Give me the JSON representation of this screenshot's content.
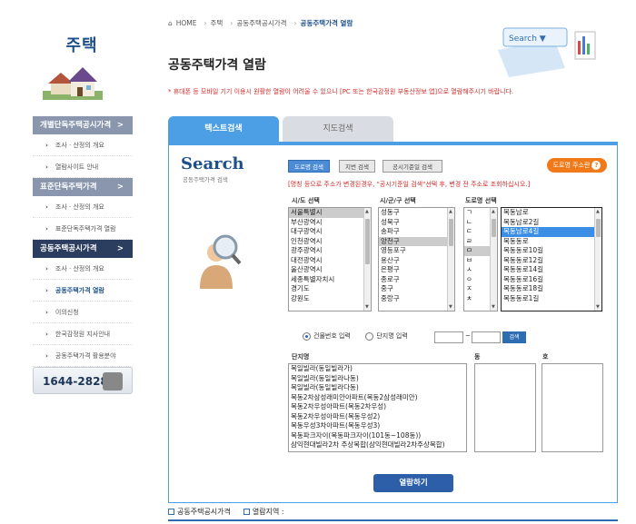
{
  "sidebar": {
    "title": "주택",
    "menu": [
      {
        "type": "head",
        "label": "개별단독주택공시가격",
        "arrow": ">"
      },
      {
        "type": "item",
        "label": "조사 · 산정의 개요"
      },
      {
        "type": "item",
        "label": "열람사이트 안내"
      },
      {
        "type": "head",
        "label": "표준단독주택가격",
        "arrow": ">"
      },
      {
        "type": "item",
        "label": "조사 · 산정의 개요"
      },
      {
        "type": "item",
        "label": "표준단독주택가격 열람"
      },
      {
        "type": "head-active",
        "label": "공동주택공시가격",
        "arrow": ">"
      },
      {
        "type": "item",
        "label": "조사 · 산정의 개요"
      },
      {
        "type": "item-current",
        "label": "공동주택가격 열람"
      },
      {
        "type": "item",
        "label": "이의신청"
      },
      {
        "type": "item",
        "label": "한국감정원 지사안내"
      },
      {
        "type": "item",
        "label": "공동주택가격 활용분야"
      }
    ],
    "phone": "1644-2828"
  },
  "breadcrumb": {
    "home": "HOME",
    "c1": "주택",
    "c2": "공동주택공시가격",
    "current": "공동주택가격 열람"
  },
  "header": {
    "title": "공동주택가격 열람",
    "notice": "* 휴대폰 등 모바일 기기 이용시 원활한 열람이 어려울 수 있으니 [PC 또는 한국감정원 부동산정보 앱]으로 열람해주시기 바랍니다.",
    "deco_text": "Search ▼"
  },
  "tabs": {
    "text": "텍스트검색",
    "map": "지도검색"
  },
  "search": {
    "logo": "Search",
    "logo_sub": "공동주택가격 검색",
    "btn_road": "도로명 검색",
    "btn_jibun": "지번 검색",
    "btn_date": "공시기준일 검색",
    "btn_addr": "도로명 주소란",
    "warning": "[명칭 등으로 주소가 변경된경우, \"공시기준일 검색\"선택 후, 변경 전 주소로 조회하십시오.]",
    "label_sido": "시/도 선택",
    "label_sigungu": "시/군/구 선택",
    "label_road": "도로명 선택",
    "sido": [
      "서울특별시",
      "부산광역시",
      "대구광역시",
      "인천광역시",
      "광주광역시",
      "대전광역시",
      "울산광역시",
      "세종특별자치시",
      "경기도",
      "강원도"
    ],
    "sigungu": [
      "성동구",
      "성북구",
      "송파구",
      "양천구",
      "영등포구",
      "용산구",
      "은평구",
      "종로구",
      "중구",
      "중랑구"
    ],
    "initials": [
      "ㄱ",
      "ㄴ",
      "ㄷ",
      "ㄹ",
      "ㅁ",
      "ㅂ",
      "ㅅ",
      "ㅇ",
      "ㅈ",
      "ㅊ"
    ],
    "roads": [
      "목동남로",
      "목동남로2길",
      "목동남로4길",
      "목동동로",
      "목동동로10길",
      "목동동로12길",
      "목동동로14길",
      "목동동로16길",
      "목동동로18길",
      "목동동로1길"
    ],
    "radio_building": "건물번호 입력",
    "radio_complex": "단지명 입력",
    "dash": "~",
    "btn_search_small": "검색",
    "label_complex": "단지명",
    "label_dong": "동",
    "label_ho": "호",
    "complexes": [
      "목일빌라(동일빌라가)",
      "목일빌라(동일빌라나동)",
      "목일빌라(동일빌라다동)",
      "목동2차삼성래미안아파트(목동2삼성래미안)",
      "목동2차우성아파트(목동2차우성)",
      "목동2차우성아파트(목동우성2)",
      "목동우성3차아파트(목동우성3)",
      "목동파크자이(목동파크자이(101동~108동))",
      "삼익현대빌라2차 주상복합(삼익현대빌라2차주상복합)"
    ],
    "btn_view": "열람하기"
  },
  "footer": {
    "item1": "공동주택공시가격",
    "item2": "열람지역 :"
  }
}
